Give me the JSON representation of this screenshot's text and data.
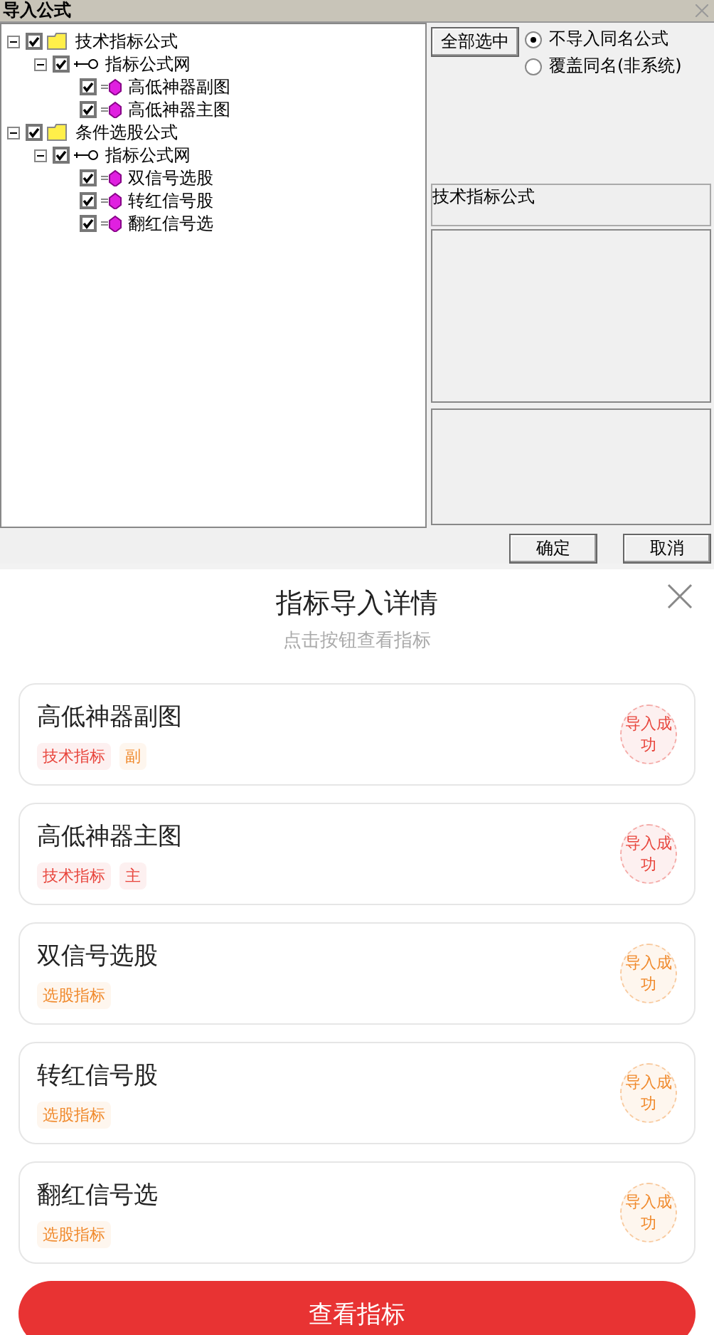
{
  "window": {
    "title": "导入公式"
  },
  "tree": [
    {
      "label": "技术指标公式",
      "kind": "folder",
      "checked": true,
      "expanded": true,
      "children": [
        {
          "label": "指标公式网",
          "kind": "net",
          "checked": true,
          "expanded": true,
          "children": [
            {
              "label": "高低神器副图",
              "kind": "formula",
              "checked": true
            },
            {
              "label": "高低神器主图",
              "kind": "formula",
              "checked": true
            }
          ]
        }
      ]
    },
    {
      "label": "条件选股公式",
      "kind": "folder",
      "checked": true,
      "expanded": true,
      "children": [
        {
          "label": "指标公式网",
          "kind": "net",
          "checked": true,
          "expanded": true,
          "children": [
            {
              "label": "双信号选股",
              "kind": "formula",
              "checked": true
            },
            {
              "label": "转红信号股",
              "kind": "formula",
              "checked": true
            },
            {
              "label": "翻红信号选",
              "kind": "formula",
              "checked": true
            }
          ]
        }
      ]
    }
  ],
  "select_all_button": "全部选中",
  "options": [
    {
      "label": "不导入同名公式",
      "selected": true
    },
    {
      "label": "覆盖同名(非系统)",
      "selected": false
    }
  ],
  "category_field": "技术指标公式",
  "buttons": [
    "确定",
    "取消"
  ],
  "details": {
    "title": "指标导入详情",
    "subtitle": "点击按钮查看指标",
    "cards": [
      {
        "name": "高低神器副图",
        "tags": [
          {
            "label": "技术指标",
            "color": "#e8453c"
          },
          {
            "label": "副",
            "color": "#f0892b"
          }
        ],
        "status": "导入成功",
        "color": "#e8453c"
      },
      {
        "name": "高低神器主图",
        "tags": [
          {
            "label": "技术指标",
            "color": "#e8453c"
          },
          {
            "label": "主",
            "color": "#e8453c"
          }
        ],
        "status": "导入成功",
        "color": "#e8453c"
      },
      {
        "name": "双信号选股",
        "tags": [
          {
            "label": "选股指标",
            "color": "#f0892b"
          }
        ],
        "status": "导入成功",
        "color": "#f0892b"
      },
      {
        "name": "转红信号股",
        "tags": [
          {
            "label": "选股指标",
            "color": "#f0892b"
          }
        ],
        "status": "导入成功",
        "color": "#f0892b"
      },
      {
        "name": "翻红信号选",
        "tags": [
          {
            "label": "选股指标",
            "color": "#f0892b"
          }
        ],
        "status": "导入成功",
        "color": "#f0892b"
      }
    ],
    "action_button": "查看指标"
  }
}
